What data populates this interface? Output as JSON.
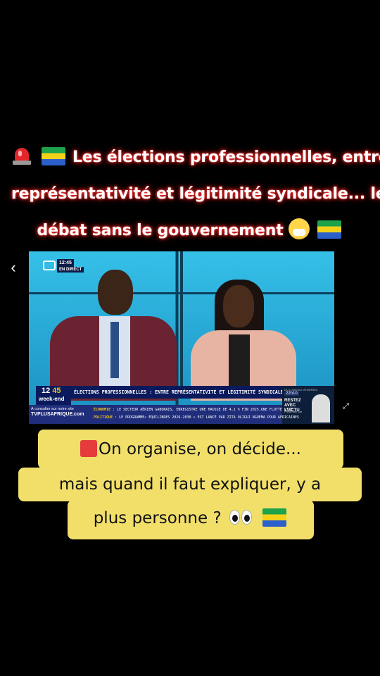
{
  "post": {
    "caption_line1": "Les élections professionnelles, entre",
    "caption_line2": "représentativité et légitimité syndicale... le",
    "caption_line3": "débat sans le gouvernement"
  },
  "video": {
    "on_screen_clock": "12:45",
    "live_badge": "EN DIRECT",
    "lower_third_time_hour": "12",
    "lower_third_time_min": "45",
    "lower_third_sub": "week-end",
    "headline": "ÉLECTIONS PROFESSIONNELLES : ENTRE REPRÉSENTATIVITÉ ET LÉGITIMITÉ SYNDICALE",
    "site_prompt": "À consulter sur notre site",
    "site_url": "TVPLUSAFRIQUE.com",
    "ticker": [
      {
        "tag": "ÉCONOMIE",
        "text": ": LE SECTEUR AÉRIEN GABONAIS, ENREGISTRE UNE HAUSSE DE 4,1 % FIN 2025,UNE FLOTTE VIVE"
      },
      {
        "tag": "POLITIQUE",
        "text": ": LE PROGRAMME« ÉQUILIBRES 2026-2030 » EST LANCÉ PAR ZITA OLIGUI NGUEMA POUR AFRICAINES"
      }
    ],
    "promo": {
      "small": "DU LUNDI AU VENDREDI",
      "time": "22h10",
      "title": "RESTEZ AVEC L'ACTU",
      "by": "Présentée par"
    }
  },
  "overlay": {
    "line1": "On organise, on décide...",
    "line2": "mais quand il faut expliquer, y a",
    "line3": "plus personne ?"
  },
  "controls": {
    "back_glyph": "‹",
    "expand_glyph": "⤢"
  }
}
